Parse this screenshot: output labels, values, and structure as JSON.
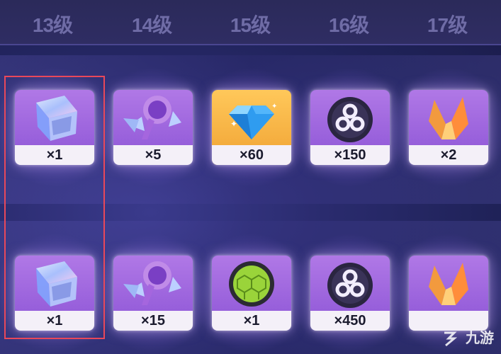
{
  "header": {
    "levels": [
      "13级",
      "14级",
      "15级",
      "16级",
      "17级"
    ]
  },
  "rows": [
    {
      "items": [
        {
          "icon": "prism-cube-icon",
          "count": "×1",
          "bg": "purple"
        },
        {
          "icon": "purple-wing-crystal-icon",
          "count": "×5",
          "bg": "purple"
        },
        {
          "icon": "blue-crystal-icon",
          "count": "×60",
          "bg": "gold"
        },
        {
          "icon": "triskelion-disc-icon",
          "count": "×150",
          "bg": "purple"
        },
        {
          "icon": "orange-shard-icon",
          "count": "×2",
          "bg": "purple"
        }
      ]
    },
    {
      "items": [
        {
          "icon": "prism-cube-icon",
          "count": "×1",
          "bg": "purple"
        },
        {
          "icon": "purple-wing-crystal-icon",
          "count": "×15",
          "bg": "purple"
        },
        {
          "icon": "green-hex-orb-icon",
          "count": "×1",
          "bg": "purple"
        },
        {
          "icon": "triskelion-disc-icon",
          "count": "×450",
          "bg": "purple"
        },
        {
          "icon": "orange-shard-icon",
          "count": "",
          "bg": "purple"
        }
      ]
    }
  ],
  "watermark": {
    "text": "九游"
  },
  "colors": {
    "highlight": "#e9485a",
    "card_purple": "#9a62dc",
    "card_gold": "#f5b13f",
    "level_text": "#6f6ca6"
  }
}
